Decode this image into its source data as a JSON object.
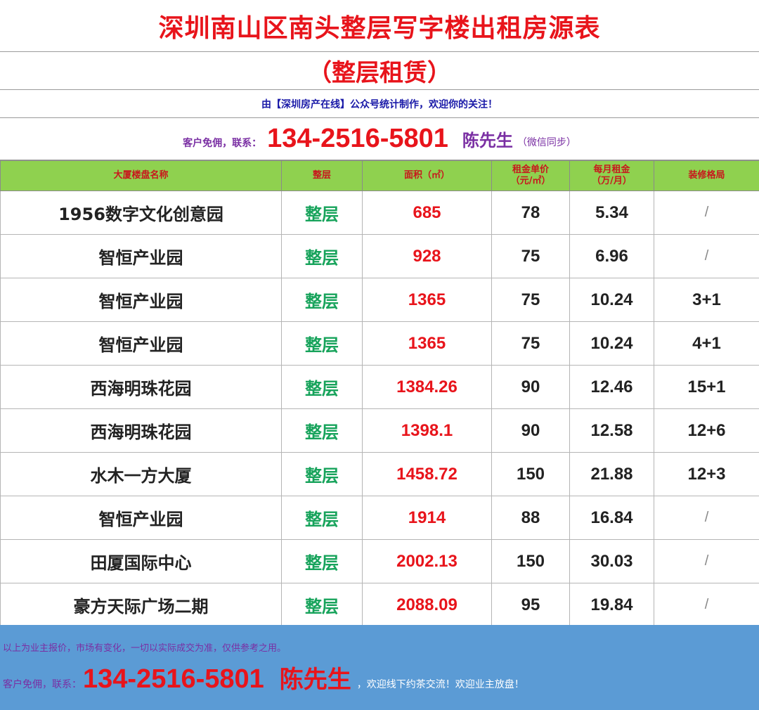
{
  "header": {
    "title": "深圳南山区南头整层写字楼出租房源表",
    "subtitle": "（整层租赁）",
    "credit": "由【深圳房产在线】公众号统计制作，欢迎你的关注！",
    "contact_prefix": "客户免佣，联系：",
    "phone": "134-2516-5801",
    "person": "陈先生",
    "wechat": "（微信同步）"
  },
  "table": {
    "columns": [
      "大厦楼盘名称",
      "整层",
      "面积（㎡）",
      "租金单价\n（元/㎡）",
      "每月租金\n（万/月）",
      "装修格局"
    ],
    "rows": [
      [
        "1956数字文化创意园",
        "整层",
        "685",
        "78",
        "5.34",
        "/"
      ],
      [
        "智恒产业园",
        "整层",
        "928",
        "75",
        "6.96",
        "/"
      ],
      [
        "智恒产业园",
        "整层",
        "1365",
        "75",
        "10.24",
        "3+1"
      ],
      [
        "智恒产业园",
        "整层",
        "1365",
        "75",
        "10.24",
        "4+1"
      ],
      [
        "西海明珠花园",
        "整层",
        "1384.26",
        "90",
        "12.46",
        "15+1"
      ],
      [
        "西海明珠花园",
        "整层",
        "1398.1",
        "90",
        "12.58",
        "12+6"
      ],
      [
        "水木一方大厦",
        "整层",
        "1458.72",
        "150",
        "21.88",
        "12+3"
      ],
      [
        "智恒产业园",
        "整层",
        "1914",
        "88",
        "16.84",
        "/"
      ],
      [
        "田厦国际中心",
        "整层",
        "2002.13",
        "150",
        "30.03",
        "/"
      ],
      [
        "豪方天际广场二期",
        "整层",
        "2088.09",
        "95",
        "19.84",
        "/"
      ]
    ]
  },
  "footer": {
    "note": "以上为业主报价，市场有变化，一切以实际成交为准，仅供参考之用。",
    "contact_prefix": "客户免佣，联系：",
    "phone": "134-2516-5801",
    "person": "陈先生",
    "suffix": "，欢迎线下约茶交流！欢迎业主放盘！"
  },
  "colors": {
    "title_red": "#e8141b",
    "header_green": "#8fd14f",
    "floor_green": "#17a35b",
    "purple": "#7a2fa3",
    "footer_blue": "#5b9bd5"
  }
}
